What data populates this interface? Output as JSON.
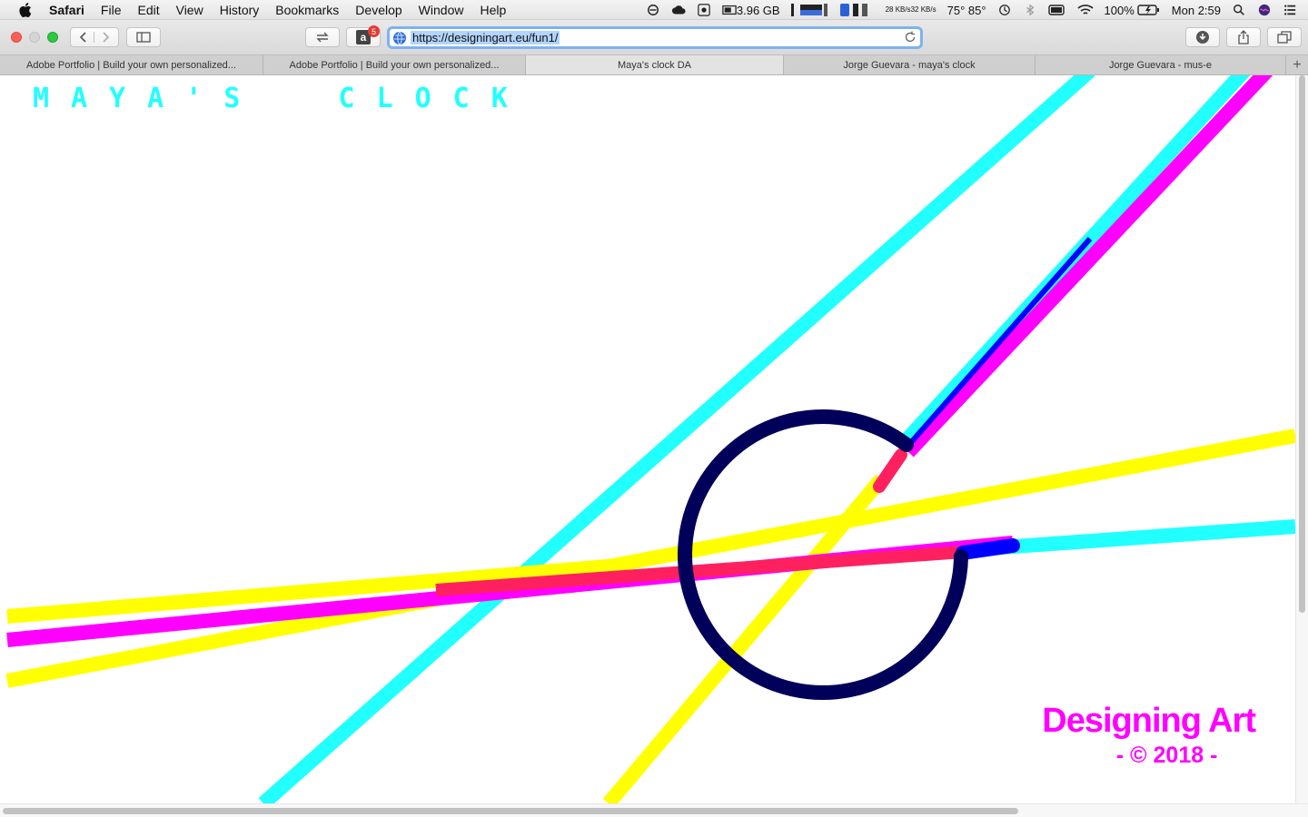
{
  "menubar": {
    "items": [
      "Safari",
      "File",
      "Edit",
      "View",
      "History",
      "Bookmarks",
      "Develop",
      "Window",
      "Help"
    ],
    "memory": "3.96 GB",
    "net_up": "28 KB/s",
    "net_down": "32 KB/s",
    "temps": "75° 85°",
    "battery": "100%",
    "clock": "Mon 2:59"
  },
  "toolbar": {
    "url": "https://designingart.eu/fun1/",
    "badge_count": "5"
  },
  "tabs": [
    {
      "label": "Adobe Portfolio | Build your own personalized..."
    },
    {
      "label": "Adobe Portfolio | Build your own personalized..."
    },
    {
      "label": "Maya's clock DA"
    },
    {
      "label": "Jorge Guevara - maya's clock"
    },
    {
      "label": "Jorge Guevara - mus-e"
    }
  ],
  "page": {
    "title": "MAYA'S  CLOCK",
    "brand_name": "Designing Art",
    "brand_copy": "- © 2018 -"
  },
  "colors": {
    "cyan": "#22ffff",
    "magenta": "#ff00ff",
    "yellow": "#ffff00",
    "red": "#ff2060",
    "navy": "#00005a",
    "blue": "#0000ff"
  }
}
